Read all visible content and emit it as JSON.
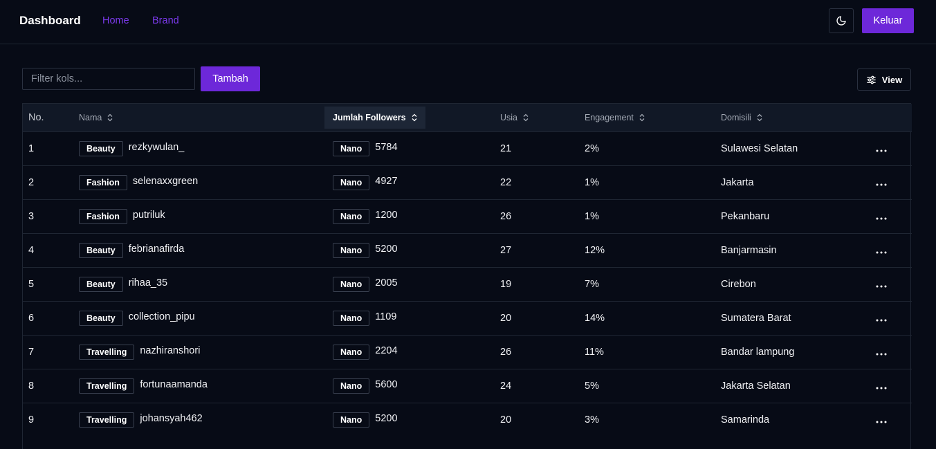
{
  "header": {
    "title": "Dashboard",
    "nav": [
      "Home",
      "Brand"
    ],
    "logout_label": "Keluar"
  },
  "toolbar": {
    "filter_placeholder": "Filter kols...",
    "add_label": "Tambah",
    "view_label": "View"
  },
  "table": {
    "columns": [
      "No.",
      "Nama",
      "Jumlah Followers",
      "Usia",
      "Engagement",
      "Domisili"
    ],
    "rows": [
      {
        "no": "1",
        "category": "Beauty",
        "name": "rezkywulan_",
        "tier": "Nano",
        "followers": "5784",
        "age": "21",
        "engagement": "2%",
        "domicile": "Sulawesi Selatan"
      },
      {
        "no": "2",
        "category": "Fashion",
        "name": "selenaxxgreen",
        "tier": "Nano",
        "followers": "4927",
        "age": "22",
        "engagement": "1%",
        "domicile": "Jakarta"
      },
      {
        "no": "3",
        "category": "Fashion",
        "name": "putriluk",
        "tier": "Nano",
        "followers": "1200",
        "age": "26",
        "engagement": "1%",
        "domicile": "Pekanbaru"
      },
      {
        "no": "4",
        "category": "Beauty",
        "name": "febrianafirda",
        "tier": "Nano",
        "followers": "5200",
        "age": "27",
        "engagement": "12%",
        "domicile": "Banjarmasin"
      },
      {
        "no": "5",
        "category": "Beauty",
        "name": "rihaa_35",
        "tier": "Nano",
        "followers": "2005",
        "age": "19",
        "engagement": "7%",
        "domicile": "Cirebon"
      },
      {
        "no": "6",
        "category": "Beauty",
        "name": "collection_pipu",
        "tier": "Nano",
        "followers": "1109",
        "age": "20",
        "engagement": "14%",
        "domicile": "Sumatera Barat"
      },
      {
        "no": "7",
        "category": "Travelling",
        "name": "nazhiranshori",
        "tier": "Nano",
        "followers": "2204",
        "age": "26",
        "engagement": "11%",
        "domicile": "Bandar lampung"
      },
      {
        "no": "8",
        "category": "Travelling",
        "name": "fortunaamanda",
        "tier": "Nano",
        "followers": "5600",
        "age": "24",
        "engagement": "5%",
        "domicile": "Jakarta Selatan"
      },
      {
        "no": "9",
        "category": "Travelling",
        "name": "johansyah462",
        "tier": "Nano",
        "followers": "5200",
        "age": "20",
        "engagement": "3%",
        "domicile": "Samarinda"
      }
    ],
    "row_action_icon": "ellipsis-icon"
  },
  "colors": {
    "background": "#070b16",
    "accent": "#6d28d9",
    "nav_link": "#7c3aed",
    "border": "#1f2633",
    "header_row": "#111826"
  }
}
